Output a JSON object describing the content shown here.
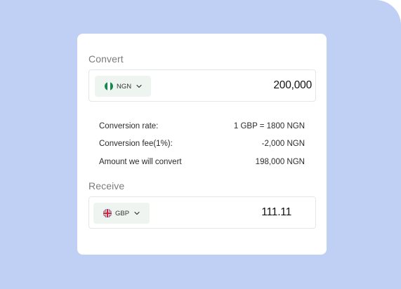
{
  "colors": {
    "background": "#c0d0f4",
    "card": "#ffffff",
    "select_bg": "#eef5f1",
    "border": "#e3e6ea"
  },
  "convert": {
    "title": "Convert",
    "currency": {
      "code": "NGN",
      "flag_icon": "nigeria-flag-icon",
      "chevron_icon": "chevron-down-icon"
    },
    "amount": "200,000"
  },
  "details": [
    {
      "label": "Conversion rate:",
      "value": "1 GBP = 1800 NGN"
    },
    {
      "label": "Conversion fee(1%):",
      "value": "-2,000 NGN"
    },
    {
      "label": "Amount we will convert",
      "value": "198,000 NGN"
    }
  ],
  "receive": {
    "title": "Receive",
    "currency": {
      "code": "GBP",
      "flag_icon": "uk-flag-icon",
      "chevron_icon": "chevron-down-icon"
    },
    "amount": "111.11"
  }
}
